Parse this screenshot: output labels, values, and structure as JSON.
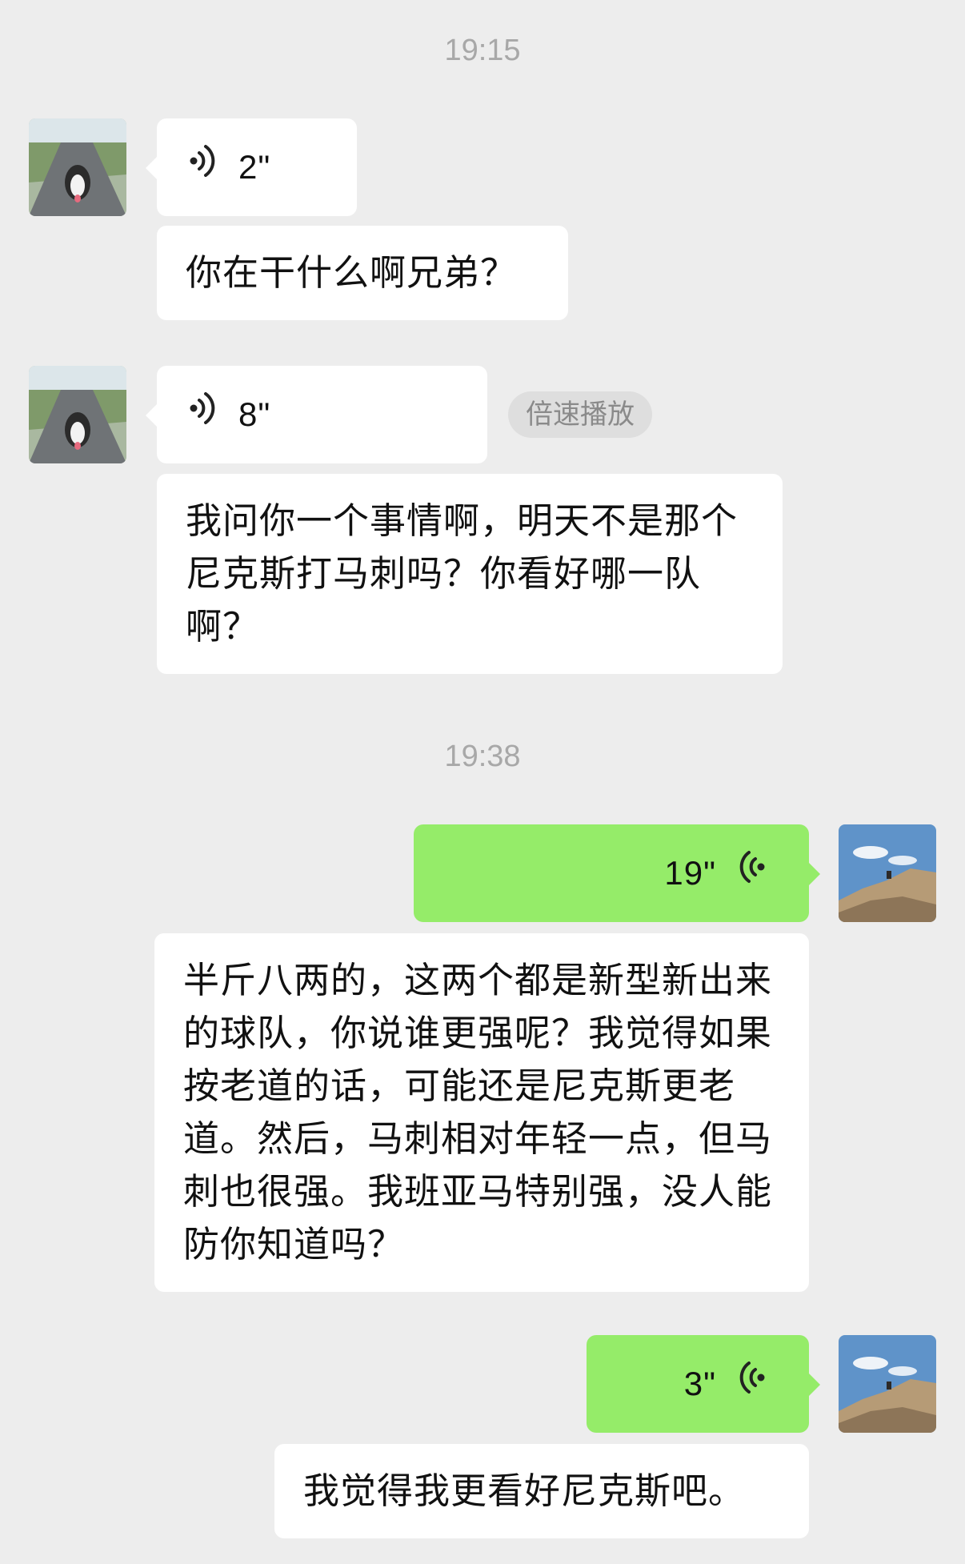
{
  "timestamps": [
    "19:15",
    "19:38"
  ],
  "messages": {
    "m1": {
      "type": "voice",
      "sender": "friend",
      "duration": "2\""
    },
    "m2": {
      "type": "text",
      "sender": "friend",
      "text": "你在干什么啊兄弟？"
    },
    "m3": {
      "type": "voice",
      "sender": "friend",
      "duration": "8\"",
      "action": "倍速播放"
    },
    "m4": {
      "type": "text",
      "sender": "friend",
      "text": "我问你一个事情啊，明天不是那个尼克斯打马刺吗？你看好哪一队啊？"
    },
    "m5": {
      "type": "voice",
      "sender": "me",
      "duration": "19\""
    },
    "m6": {
      "type": "text",
      "sender": "me",
      "text": "半斤八两的，这两个都是新型新出来的球队，你说谁更强呢？我觉得如果按老道的话，可能还是尼克斯更老道。然后，马刺相对年轻一点，但马刺也很强。我班亚马特别强，没人能防你知道吗？"
    },
    "m7": {
      "type": "voice",
      "sender": "me",
      "duration": "3\""
    },
    "m8": {
      "type": "text",
      "sender": "me",
      "text": "我觉得我更看好尼克斯吧。"
    }
  },
  "avatars": {
    "friend": "dog-on-road-avatar",
    "me": "person-on-rocks-sky-avatar"
  },
  "colors": {
    "background": "#ededed",
    "incoming_bubble": "#ffffff",
    "outgoing_bubble": "#95ec69",
    "timestamp": "#a8a8a8"
  }
}
